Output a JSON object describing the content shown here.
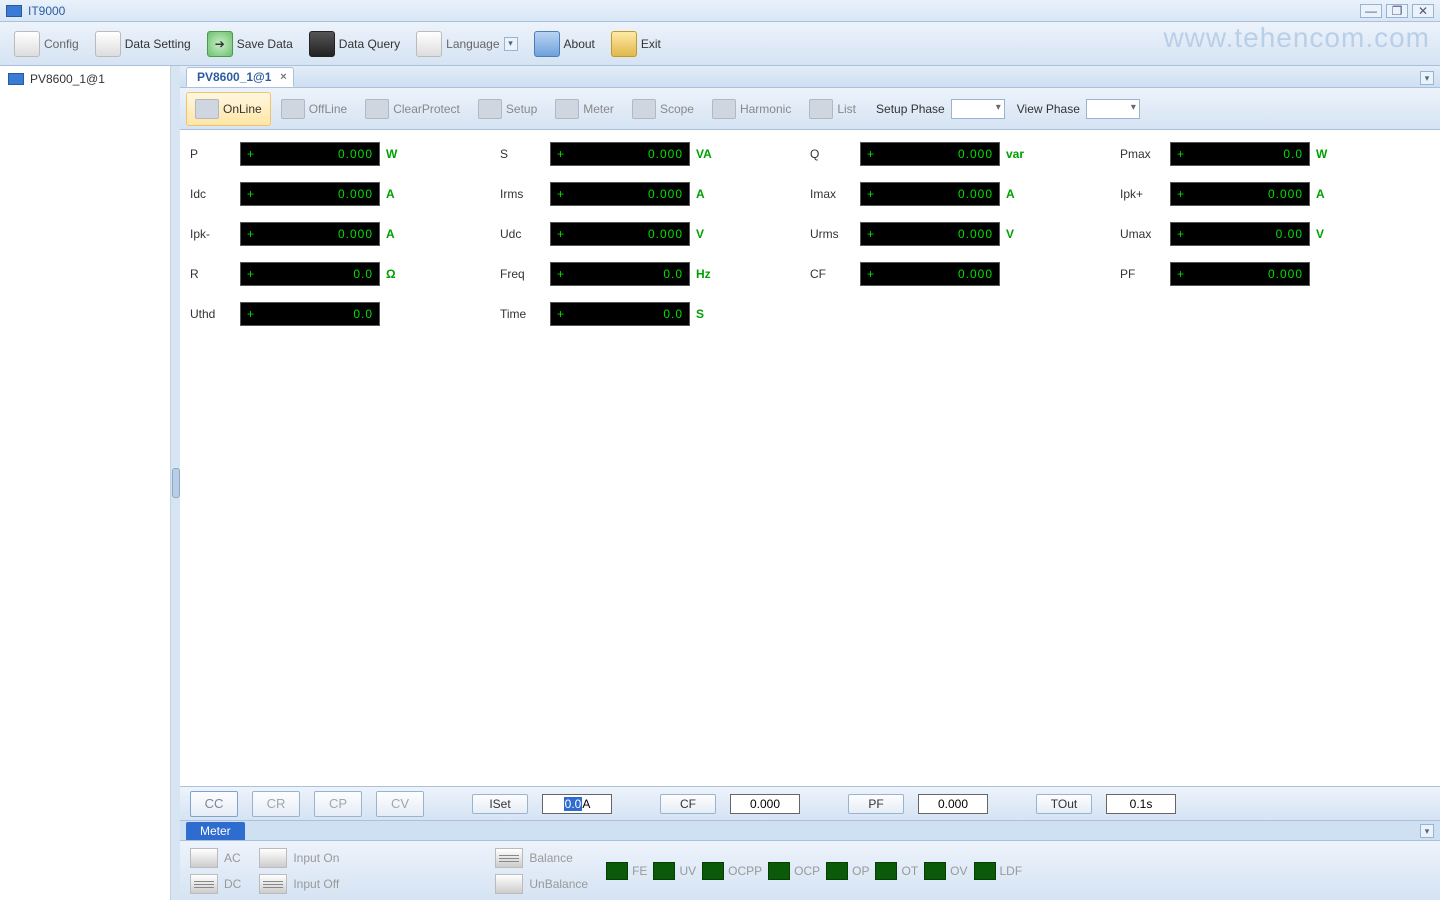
{
  "title": "IT9000",
  "watermark": "www.tehencom.com",
  "toolbar": {
    "config": "Config",
    "data_setting": "Data Setting",
    "save_data": "Save Data",
    "data_query": "Data Query",
    "language": "Language",
    "about": "About",
    "exit": "Exit"
  },
  "tree": {
    "node1": "PV8600_1@1"
  },
  "tab": {
    "label": "PV8600_1@1"
  },
  "subtoolbar": {
    "online": "OnLine",
    "offline": "OffLine",
    "clearprotect": "ClearProtect",
    "setup": "Setup",
    "meter": "Meter",
    "scope": "Scope",
    "harmonic": "Harmonic",
    "list": "List",
    "setup_phase": "Setup Phase",
    "view_phase": "View Phase"
  },
  "readings": [
    [
      {
        "label": "P",
        "value": "0.000",
        "unit": "W"
      },
      {
        "label": "S",
        "value": "0.000",
        "unit": "VA"
      },
      {
        "label": "Q",
        "value": "0.000",
        "unit": "var"
      },
      {
        "label": "Pmax",
        "value": "0.0",
        "unit": "W"
      }
    ],
    [
      {
        "label": "Idc",
        "value": "0.000",
        "unit": "A"
      },
      {
        "label": "Irms",
        "value": "0.000",
        "unit": "A"
      },
      {
        "label": "Imax",
        "value": "0.000",
        "unit": "A"
      },
      {
        "label": "Ipk+",
        "value": "0.000",
        "unit": "A"
      }
    ],
    [
      {
        "label": "Ipk-",
        "value": "0.000",
        "unit": "A"
      },
      {
        "label": "Udc",
        "value": "0.000",
        "unit": "V"
      },
      {
        "label": "Urms",
        "value": "0.000",
        "unit": "V"
      },
      {
        "label": "Umax",
        "value": "0.00",
        "unit": "V"
      }
    ],
    [
      {
        "label": "R",
        "value": "0.0",
        "unit": "Ω"
      },
      {
        "label": "Freq",
        "value": "0.0",
        "unit": "Hz"
      },
      {
        "label": "CF",
        "value": "0.000",
        "unit": ""
      },
      {
        "label": "PF",
        "value": "0.000",
        "unit": ""
      }
    ],
    [
      {
        "label": "Uthd",
        "value": "0.0",
        "unit": ""
      },
      {
        "label": "Time",
        "value": "0.0",
        "unit": "S"
      }
    ]
  ],
  "modes": {
    "cc": "CC",
    "cr": "CR",
    "cp": "CP",
    "cv": "CV"
  },
  "params": {
    "iset_label": "ISet",
    "iset_value": "0.0",
    "iset_unit": "A",
    "cf_label": "CF",
    "cf_value": "0.000",
    "pf_label": "PF",
    "pf_value": "0.000",
    "tout_label": "TOut",
    "tout_value": "0.1s"
  },
  "metertab": "Meter",
  "status": {
    "ac": "AC",
    "dc": "DC",
    "input_on": "Input On",
    "input_off": "Input Off",
    "balance": "Balance",
    "unbalance": "UnBalance",
    "indicators": [
      "FE",
      "UV",
      "OCPP",
      "OCP",
      "OP",
      "OT",
      "OV",
      "LDF"
    ]
  }
}
